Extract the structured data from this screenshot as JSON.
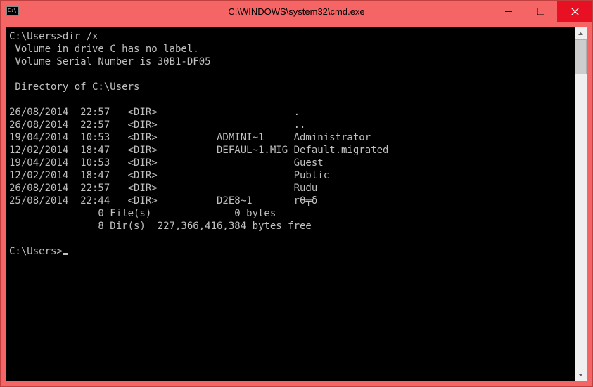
{
  "window": {
    "title": "C:\\WINDOWS\\system32\\cmd.exe"
  },
  "prompt1": "C:\\Users>",
  "command": "dir /x",
  "volume_line": " Volume in drive C has no label.",
  "serial_line": " Volume Serial Number is 30B1-DF05",
  "directory_line": " Directory of C:\\Users",
  "entries": [
    {
      "date": "26/08/2014",
      "time": "22:57",
      "type": "<DIR>",
      "short": "",
      "long": "."
    },
    {
      "date": "26/08/2014",
      "time": "22:57",
      "type": "<DIR>",
      "short": "",
      "long": ".."
    },
    {
      "date": "19/04/2014",
      "time": "10:53",
      "type": "<DIR>",
      "short": "ADMINI~1",
      "long": "Administrator"
    },
    {
      "date": "12/02/2014",
      "time": "18:47",
      "type": "<DIR>",
      "short": "DEFAUL~1.MIG",
      "long": "Default.migrated"
    },
    {
      "date": "19/04/2014",
      "time": "10:53",
      "type": "<DIR>",
      "short": "",
      "long": "Guest"
    },
    {
      "date": "12/02/2014",
      "time": "18:47",
      "type": "<DIR>",
      "short": "",
      "long": "Public"
    },
    {
      "date": "26/08/2014",
      "time": "22:57",
      "type": "<DIR>",
      "short": "",
      "long": "Rudu"
    },
    {
      "date": "25/08/2014",
      "time": "22:44",
      "type": "<DIR>",
      "short": "D2E8~1",
      "long": "rθ╤δ"
    }
  ],
  "summary_files": "               0 File(s)              0 bytes",
  "summary_dirs": "               8 Dir(s)  227,366,416,384 bytes free",
  "prompt2": "C:\\Users>"
}
